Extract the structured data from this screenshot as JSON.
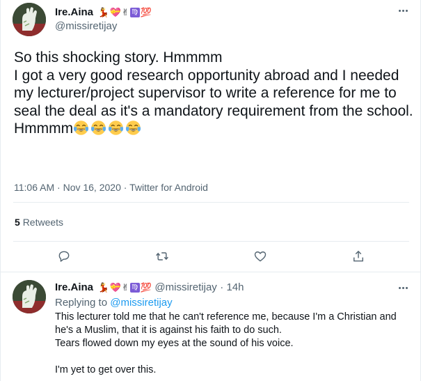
{
  "tweet": {
    "display_name": "Ire.Aina",
    "badges": [
      "💃",
      "💝",
      "✌",
      "♍",
      "💯"
    ],
    "handle": "@missiretijay",
    "body_lines": [
      "So this shocking story. Hmmmm",
      "I got a very good research opportunity abroad and I needed my lecturer/project supervisor to write a reference for me to seal the deal as it's a mandatory requirement from the school.",
      "Hmmmm"
    ],
    "emoji_name": "face-with-tears-of-joy",
    "emoji_count": 4,
    "time": "11:06 AM",
    "date": "Nov 16, 2020",
    "source": "Twitter for Android",
    "retweet_count": "5",
    "retweet_label": "Retweets",
    "actions": [
      "reply-icon",
      "retweet-icon",
      "like-icon",
      "share-icon"
    ]
  },
  "reply": {
    "display_name": "Ire.Aina",
    "handle": "@missiretijay",
    "age": "14h",
    "replying_prefix": "Replying to",
    "replying_to": "@missiretijay",
    "text_lines": [
      "This lecturer told me that he can't reference me, because I'm a Christian and he's a Muslim, that it is against his faith to do such.",
      "Tears flowed down my eyes at the sound of his voice.",
      "",
      "I'm yet to get over this."
    ]
  },
  "colors": {
    "text": "#0f1419",
    "secondary": "#536471",
    "link": "#1d9bf0",
    "border": "#e6ecf0",
    "virgo_badge": "#7b5bd6",
    "hundred": "#e0245e"
  }
}
